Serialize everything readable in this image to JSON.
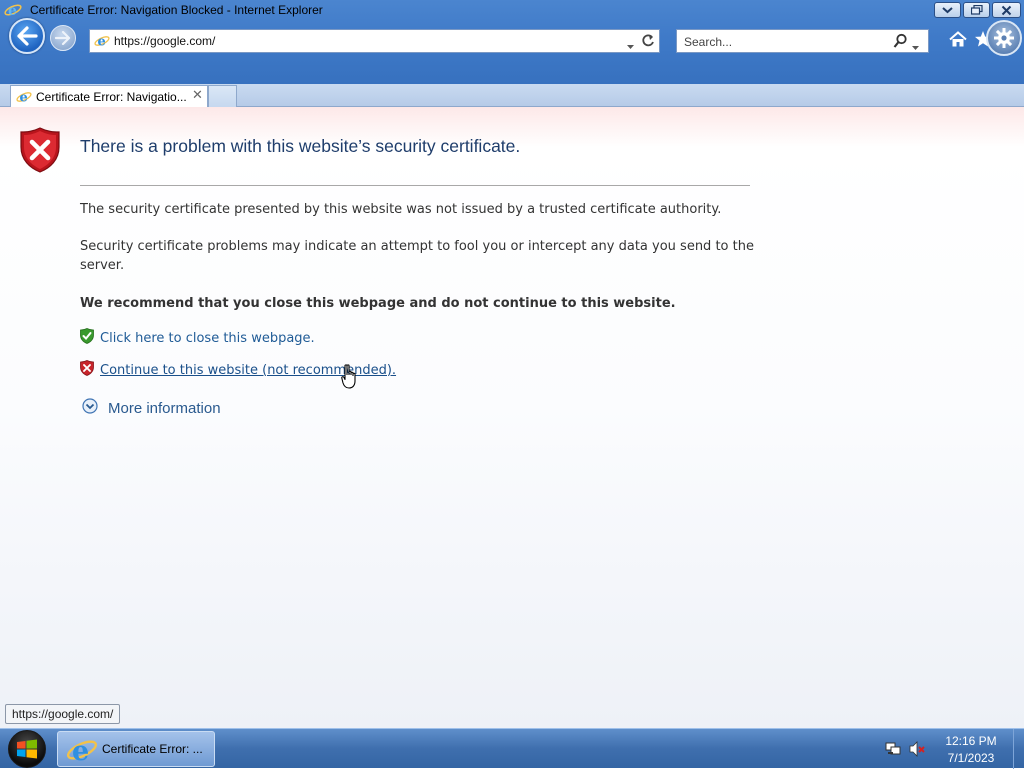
{
  "window": {
    "title": "Certificate Error: Navigation Blocked - Internet Explorer"
  },
  "toolbar": {
    "address_url": "https://google.com/",
    "search_placeholder": "Search..."
  },
  "tabs": [
    {
      "label": "Certificate Error: Navigatio...",
      "close_glyph": "✕"
    }
  ],
  "content": {
    "heading": "There is a problem with this website’s security certificate.",
    "paragraph1": "The security certificate presented by this website was not issued by a trusted certificate authority.",
    "paragraph2": "Security certificate problems may indicate an attempt to fool you or intercept any data you send to the server.",
    "recommendation": "We recommend that you close this webpage and do not continue to this website.",
    "close_link": "Click here to close this webpage.",
    "continue_link": "Continue to this website (not recommended).",
    "more_info": "More information"
  },
  "status_tip": "https://google.com/",
  "taskbar": {
    "ie_task_label": "Certificate Error: ...",
    "clock_time": "12:16 PM",
    "clock_date": "7/1/2023"
  },
  "icons": {
    "browser": "internet-explorer-icon",
    "back": "back-arrow-icon",
    "forward": "forward-arrow-icon",
    "error_shield": "red-x-shield-icon",
    "safe_shield": "green-check-shield-icon",
    "home": "home-icon",
    "favorites": "star-icon",
    "tools": "gear-icon",
    "windows": "windows-logo-icon"
  },
  "colors": {
    "error_red": "#c8242b",
    "safe_green": "#3a9a2e",
    "link_blue": "#1f5b96",
    "heading_blue": "#1f3d6b"
  }
}
